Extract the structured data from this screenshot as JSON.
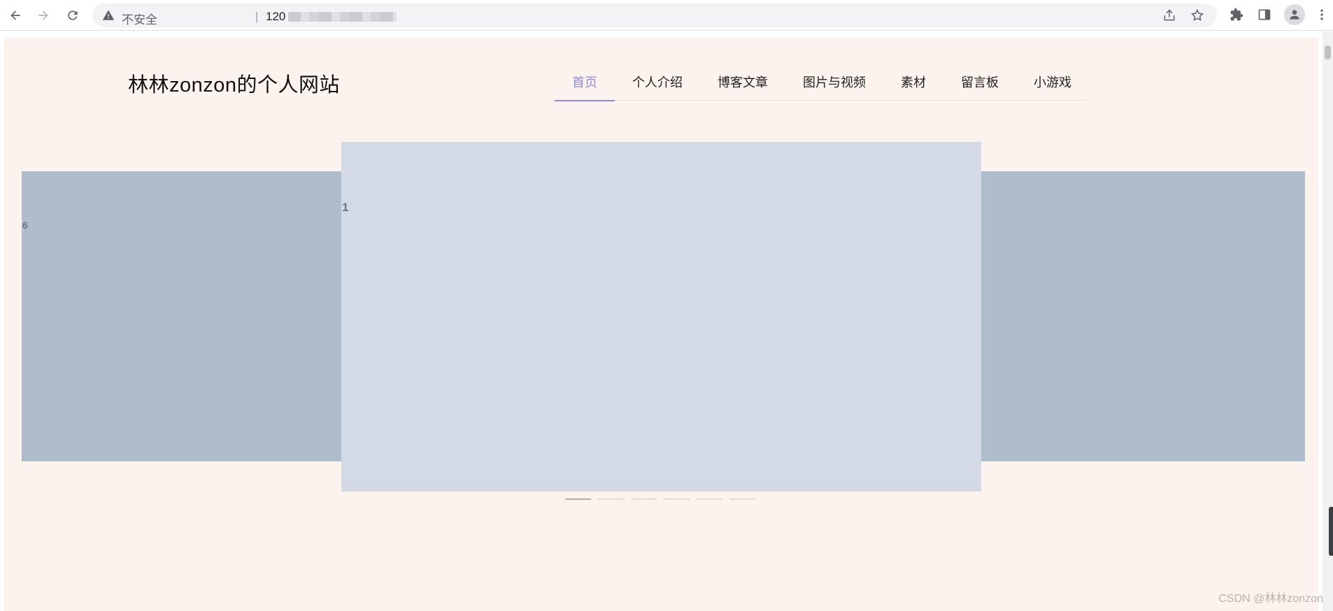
{
  "browser": {
    "security_label": "不安全",
    "separator": "|",
    "url": "120"
  },
  "site": {
    "title": "林林zonzon的个人网站",
    "nav": [
      {
        "label": "首页",
        "active": true
      },
      {
        "label": "个人介绍",
        "active": false
      },
      {
        "label": "博客文章",
        "active": false
      },
      {
        "label": "图片与视频",
        "active": false
      },
      {
        "label": "素材",
        "active": false
      },
      {
        "label": "留言板",
        "active": false
      },
      {
        "label": "小游戏",
        "active": false
      }
    ],
    "accent_color": "#8f8ae6"
  },
  "carousel": {
    "left_slide_label": "6",
    "center_slide_label": "1",
    "indicator_count": 6,
    "active_indicator": 0
  },
  "watermark": "CSDN @林林zonzon"
}
